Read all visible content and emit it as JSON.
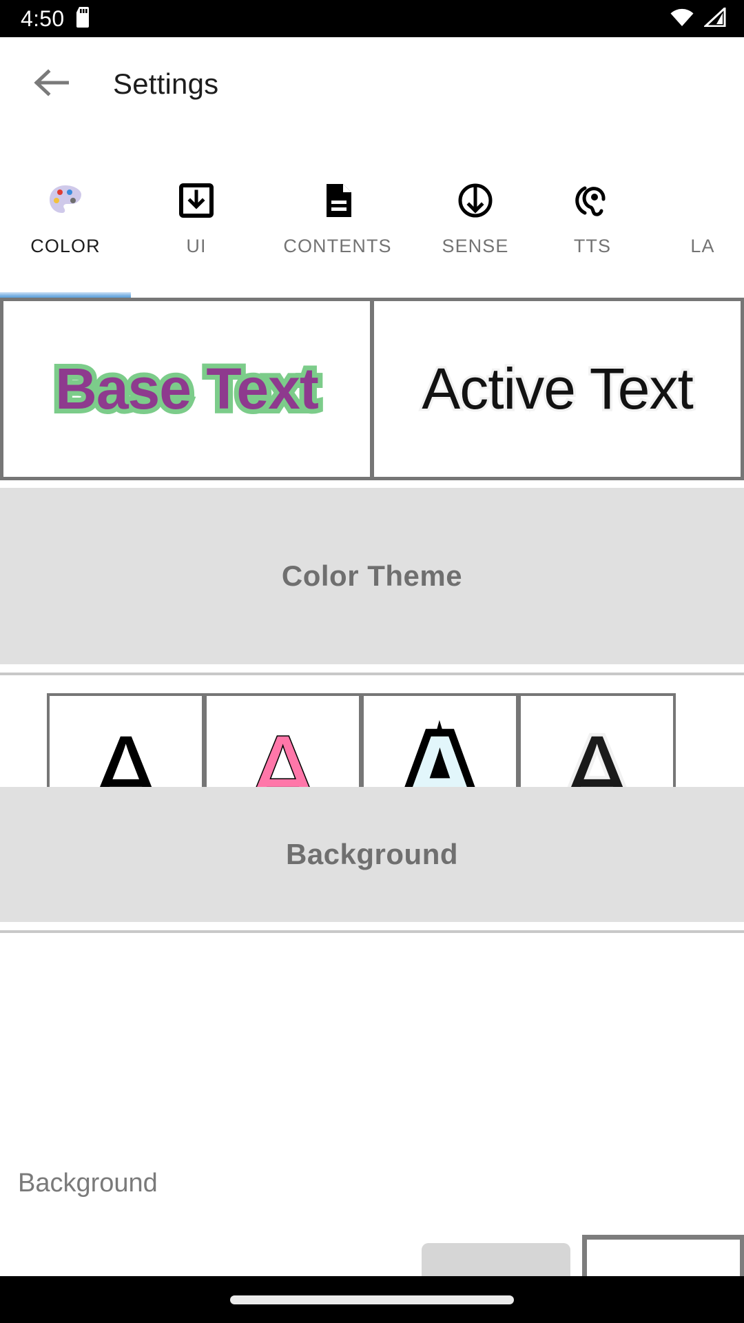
{
  "status_bar": {
    "clock": "4:50",
    "icons": [
      "sd-card-icon",
      "wifi-icon",
      "cellular-signal-icon"
    ]
  },
  "app_bar": {
    "back_icon": "arrow-back-icon",
    "title": "Settings"
  },
  "tabs": {
    "active": "COLOR",
    "items": [
      {
        "label": "COLOR",
        "icon": "palette-icon",
        "active": true
      },
      {
        "label": "UI",
        "icon": "download-box-icon",
        "active": false
      },
      {
        "label": "CONTENTS",
        "icon": "document-icon",
        "active": false
      },
      {
        "label": "SENSE",
        "icon": "arrow-down-circle-icon",
        "active": false
      },
      {
        "label": "TTS",
        "icon": "hearing-ear-icon",
        "active": false
      },
      {
        "label": "LA",
        "icon": "none",
        "active": false
      }
    ]
  },
  "preview": {
    "base": {
      "text": "Base Text",
      "fill_color": "#8e3a8e",
      "outline_color": "#7ccc8a"
    },
    "active": {
      "text": "Active Text",
      "fill_color": "#121212",
      "outline_color": "#f2f2f2"
    }
  },
  "sections": {
    "color_theme": {
      "title": "Color Theme"
    },
    "background": {
      "title": "Background"
    }
  },
  "color_theme_swatches": [
    {
      "glyph": "A",
      "style": "plain",
      "fill_color": "#000000",
      "outline_color": "none"
    },
    {
      "glyph": "A",
      "style": "pink",
      "fill_color": "#ff77a9",
      "outline_color": "#000000"
    },
    {
      "glyph": "A",
      "style": "outline",
      "fill_color": "#e2f6fb",
      "outline_color": "#000000"
    },
    {
      "glyph": "A",
      "style": "halo",
      "fill_color": "#1a1a1a",
      "outline_color": "#f1f1f1"
    }
  ],
  "background_row": {
    "label": "Background",
    "swatch_pill_color": "#d6d6d6",
    "swatch_box_color": "#ffffff"
  },
  "nav_bar": {
    "gesture_pill": "home-gesture-pill"
  },
  "colors": {
    "section_band": "#e0e0e0",
    "frame_gray": "#767676",
    "tab_indicator": "#5a9fd8"
  }
}
